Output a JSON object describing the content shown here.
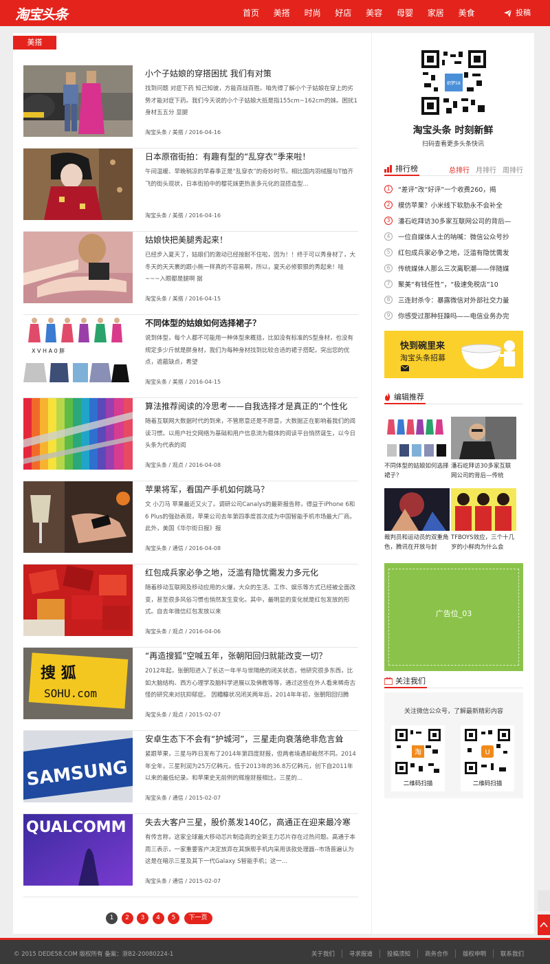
{
  "header": {
    "logo": "淘宝头条",
    "nav": [
      "首页",
      "美搭",
      "时尚",
      "好店",
      "美容",
      "母婴",
      "家居",
      "美食"
    ],
    "post_label": "投稿"
  },
  "main": {
    "section_tag": "美搭",
    "articles": [
      {
        "title": "小个子姑娘的穿搭困扰 我们有对策",
        "bold": false,
        "desc": "找到问题 对症下药 知己知彼，方能百战百胜。咱先得了解小个子姑娘在穿上的劣势才能对症下药。我们今天说的小个子姑娘大抵是指155cm~162cm的妹。困扰1 身材五五分 显腿",
        "source": "淘宝头条",
        "category": "美搭",
        "date": "2016-04-16"
      },
      {
        "title": "日本原宿街拍：有趣有型的“乱穿衣”季来啦！",
        "bold": false,
        "desc": "午间温暖、早晚稍凉的早春季正是“乱穿衣”的奇妙时节。相比国内羽绒服与T恤齐飞的街头现状，日本街拍中的樱花妹更热衷多元化的混搭造型...",
        "source": "淘宝头条",
        "category": "美搭",
        "date": "2016-04-16"
      },
      {
        "title": "姑娘快把美腿秀起来！",
        "bold": false,
        "desc": "已经步入夏天了，姑娘们的激动已经按耐不住啦，因为！！终于可以秀身材了，大冬天的天天裹的跟小熊一样真的不容易啊，所以，夏天必修狠狠的秀起来！哇~~~入眼都是腿啊 据",
        "source": "淘宝头条",
        "category": "美搭",
        "date": "2016-04-15"
      },
      {
        "title": "不同体型的姑娘如何选择裙子？",
        "bold": true,
        "desc": "说到体型，每个人都不可能用一种体型来概括，比如没有标准的S型身材，也没有规定多少斤就是胖身材，我们为每种身材找到比较合适的裙子搭配，突出您的优点，遮蔽缺点，希望",
        "source": "淘宝头条",
        "category": "美搭",
        "date": "2016-04-15"
      },
      {
        "title": "算法推荐阅读的冷思考——自我选择才是真正的“个性化",
        "bold": false,
        "desc": "随着互联网大数据时代的到来，不管愿意还是不愿意，大数据正在影响着我们的阅读习惯。以用户社交网络为基础和用户信息流为载体的阅读平台悄然诞生，以今日头条为代表的阅",
        "source": "淘宝头条",
        "category": "观点",
        "date": "2016-04-08"
      },
      {
        "title": "苹果将军，看国产手机如何跳马？",
        "bold": false,
        "desc": "文 小刀马 苹果最近又火了。调研公司Canalys的最新报告称，得益于iPhone 6和6 Plus的强劲表现，苹果公司去年第四季度首次成为中国智能手机市场最大厂商。此外，美国《华尔街日报》报",
        "source": "淘宝头条",
        "category": "通信",
        "date": "2016-04-08"
      },
      {
        "title": "红包成兵家必争之地，泛滥有隐忧需发力多元化",
        "bold": false,
        "desc": "随着移动互联网及移动应用的火爆，大众的生活、工作、娱乐等方式已经被全面改变，甚至很多风俗习惯也悄然发生变化。其中，最明显的变化就是红包发放的形式。自去年微信红包发放以来",
        "source": "淘宝头条",
        "category": "观点",
        "date": "2016-04-06"
      },
      {
        "title": "“再造搜狐”空喊五年，张朝阳回归就能改变一切？",
        "bold": false,
        "desc": "2012年起，张朝阳进入了长达一年半与世隔绝的闭关状态，他研究很多东西，比如大脑结构、西方心理学及脑科学进展以及佛教等等，通过这些在外人看来稀奇古怪的研究来对抗抑郁症。 因糟糠状况闭关两年后，2014年年初，张朝阳回归腾",
        "source": "淘宝头条",
        "category": "观点",
        "date": "2015-02-07"
      },
      {
        "title": "安卓生态下不会有“护城河”，三星走向衰落绝非危言耸",
        "bold": false,
        "desc": "紧跟苹果，三星与昨日发布了2014年第四度财报，但两者境遇却截然不同。2014年全年，三星利润为25万亿韩元，低于2013年的36.8万亿韩元，创下自2011年以来的最低纪录。和苹果史无前例的辉煌财报相比，三星的...",
        "source": "淘宝头条",
        "category": "通信",
        "date": "2015-02-07"
      },
      {
        "title": "失去大客户三星，股价蒸发140亿，高通正在迎来最冷寒",
        "bold": false,
        "desc": "有传言称，这家全球最大移动芯片制造商的全新主力芯片存在过热问题。高通于本周三表示，一家重要客户决定放弃在其旗舰手机内采用该款处理器--市场普遍认为这是在暗示三星及其下一代Galaxy S智能手机；这一...",
        "source": "淘宝头条",
        "category": "通信",
        "date": "2015-02-07"
      }
    ],
    "pager": {
      "pages": [
        "1",
        "2",
        "3",
        "4",
        "5"
      ],
      "current": "1",
      "next": "下一页"
    }
  },
  "sidebar": {
    "brand_title": "淘宝头条  时刻新鲜",
    "brand_sub": "扫码查看更多头条快讯",
    "rank": {
      "title": "排行榜",
      "tabs": [
        "总排行",
        "月排行",
        "周排行"
      ],
      "items": [
        "“差评”改“好评”一个收费260，揭",
        "模仿苹果？小米线下软肋永不会补全",
        "潘石屹拜访30多家互联网公司的背后—",
        "一位自媒体人士的呐喊：微信公众号抄",
        "红包成兵家必争之地，泛滥有隐忧需发",
        "传统媒体人那么三次离职潮——伴随媒",
        "聚美“有钱任性”，“极速免税店”10",
        "三连封杀令：暴露微信对外部社交力量",
        "你感受过那种狂躁吗——电信业务办完"
      ]
    },
    "banner": {
      "line1": "快到碗里来",
      "line2": "淘宝头条招募"
    },
    "editor": {
      "title": "编辑推荐",
      "items": [
        "不同体型的姑娘如何选择裙子？",
        "潘石屹拜访30多家互联网公司的背后—传统",
        "裁判员和运动员的双重角色，腾讯在开放与封",
        "TFBOYS效应，三个十几岁的小鲜肉为什么会"
      ]
    },
    "ad_label": "广告位_03",
    "follow": {
      "title": "关注我们",
      "tip": "关注微信公众号，了解最新精彩内容",
      "codes": [
        "二维码扫描",
        "二维码扫描"
      ]
    }
  },
  "footer": {
    "copyright": "© 2015 DEDE58.COM 版权所有 备案：浙B2-20080224-1",
    "links": [
      "关于我们",
      "寻求报道",
      "投稿须知",
      "商务合作",
      "版权申明",
      "联系我们"
    ]
  },
  "colors": {
    "brand_red": "#e4241c",
    "ad_green": "#8bc34a",
    "banner_yellow": "#fcd02b"
  }
}
